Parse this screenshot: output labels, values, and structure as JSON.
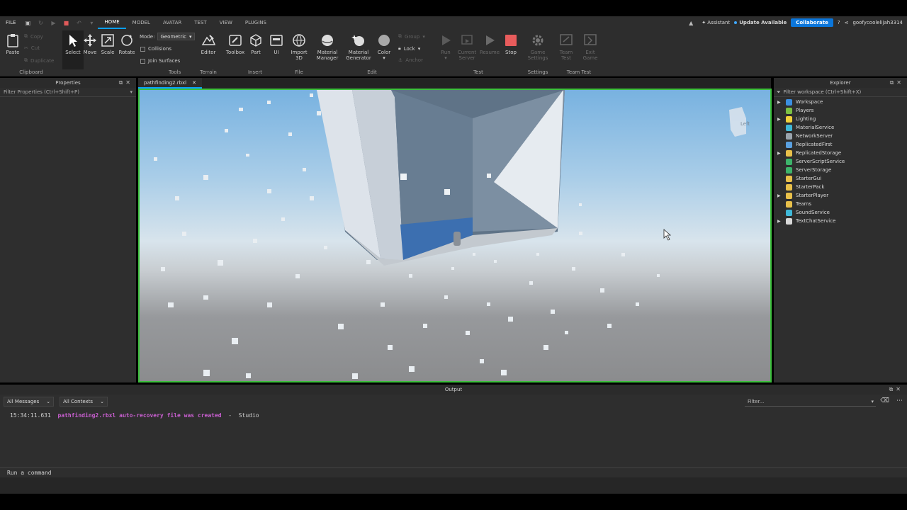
{
  "menubar": {
    "file": "FILE",
    "tabs": [
      "HOME",
      "MODEL",
      "AVATAR",
      "TEST",
      "VIEW",
      "PLUGINS"
    ],
    "active_tab": "HOME",
    "assistant": "Assistant",
    "update": "Update Available",
    "collaborate": "Collaborate",
    "username": "goofycoolelijah3314"
  },
  "ribbon": {
    "clipboard": {
      "paste": "Paste",
      "copy": "Copy",
      "cut": "Cut",
      "duplicate": "Duplicate",
      "group": "Clipboard"
    },
    "tools": {
      "select": "Select",
      "move": "Move",
      "scale": "Scale",
      "rotate": "Rotate",
      "mode_label": "Mode:",
      "mode_value": "Geometric",
      "collisions": "Collisions",
      "join_surfaces": "Join Surfaces",
      "group": "Tools"
    },
    "terrain": {
      "editor": "Editor",
      "group": "Terrain"
    },
    "insert": {
      "toolbox": "Toolbox",
      "part": "Part",
      "ui": "UI",
      "group": "Insert"
    },
    "file": {
      "import3d_1": "Import",
      "import3d_2": "3D",
      "group": "File"
    },
    "edit": {
      "material_manager_1": "Material",
      "material_manager_2": "Manager",
      "material_generator_1": "Material",
      "material_generator_2": "Generator",
      "color": "Color",
      "group_btn": "Group",
      "lock": "Lock",
      "anchor": "Anchor",
      "group": "Edit"
    },
    "test": {
      "run": "Run",
      "current_server_1": "Current",
      "current_server_2": "Server",
      "resume": "Resume",
      "stop": "Stop",
      "group": "Test"
    },
    "settings": {
      "game_settings_1": "Game",
      "game_settings_2": "Settings",
      "group": "Settings"
    },
    "team_test": {
      "team_test_1": "Team",
      "team_test_2": "Test",
      "exit_game_1": "Exit",
      "exit_game_2": "Game",
      "group": "Team Test"
    }
  },
  "properties": {
    "title": "Properties",
    "filter": "Filter Properties (Ctrl+Shift+P)"
  },
  "document": {
    "tab": "pathfinding2.rbxl"
  },
  "viewport": {
    "view_cube_label": "Left"
  },
  "explorer": {
    "title": "Explorer",
    "filter": "Filter workspace (Ctrl+Shift+X)",
    "items": [
      {
        "label": "Workspace",
        "expandable": true,
        "color": "#3b8fe0"
      },
      {
        "label": "Players",
        "expandable": false,
        "color": "#7bc043"
      },
      {
        "label": "Lighting",
        "expandable": true,
        "color": "#f2d13b"
      },
      {
        "label": "MaterialService",
        "expandable": false,
        "color": "#3fb8d8"
      },
      {
        "label": "NetworkServer",
        "expandable": false,
        "color": "#9aa4ad"
      },
      {
        "label": "ReplicatedFirst",
        "expandable": false,
        "color": "#5aa0e0"
      },
      {
        "label": "ReplicatedStorage",
        "expandable": true,
        "color": "#e8c04a"
      },
      {
        "label": "ServerScriptService",
        "expandable": false,
        "color": "#3db36a"
      },
      {
        "label": "ServerStorage",
        "expandable": false,
        "color": "#3db36a"
      },
      {
        "label": "StarterGui",
        "expandable": false,
        "color": "#e8c04a"
      },
      {
        "label": "StarterPack",
        "expandable": false,
        "color": "#e8c04a"
      },
      {
        "label": "StarterPlayer",
        "expandable": true,
        "color": "#e8c04a"
      },
      {
        "label": "Teams",
        "expandable": false,
        "color": "#e8c04a"
      },
      {
        "label": "SoundService",
        "expandable": false,
        "color": "#3fb8d8"
      },
      {
        "label": "TextChatService",
        "expandable": true,
        "color": "#d8d8d8"
      }
    ]
  },
  "output": {
    "title": "Output",
    "messages_filter": "All Messages",
    "contexts_filter": "All Contexts",
    "filter_placeholder": "Filter...",
    "log": {
      "time": "15:34:11.631",
      "message": "pathfinding2.rbxl auto-recovery file was created",
      "source": "-  Studio"
    },
    "command_placeholder": "Run a command"
  }
}
